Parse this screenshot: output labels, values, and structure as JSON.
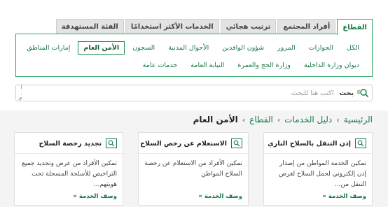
{
  "tabs": [
    {
      "label": "القطاع"
    },
    {
      "label": "أفراد المجتمع"
    },
    {
      "label": "ترتيب هجائي"
    },
    {
      "label": "الخدمات الأكثر استخدامًا"
    },
    {
      "label": "الفئة المستهدفة"
    }
  ],
  "sectors": {
    "row1": [
      "الكل",
      "الجوازات",
      "المرور",
      "شؤون الوافدين",
      "الأحوال المدنية",
      "السجون",
      "الأمن العام",
      "إمارات المناطق"
    ],
    "row2": [
      "ديوان وزارة الداخلية",
      "وزارة الحج والعمرة",
      "النيابة العامة",
      "خدمات عامة"
    ],
    "active": "الأمن العام"
  },
  "search": {
    "label": "بحث",
    "placeholder": "اكتب هنا للبحث",
    "side_marks": [
      "ا",
      ".",
      "ي"
    ]
  },
  "breadcrumb": {
    "items": [
      "الرئيسية",
      "دليل الخدمات",
      "القطاع"
    ],
    "separator": "›",
    "current": "الأمن العام"
  },
  "cards": [
    {
      "title": "إذن التنقل بالسلاح الناري",
      "description": "تمكين الخدمة المواطن من إصدار إذن إلكتروني لحمل السلاح لغرض التنقل من...",
      "link": "وصف الخدمة »"
    },
    {
      "title": "الاستعلام عن رخص السلاح",
      "description": "تمكين الأفراد من الاستعلام عن رخصة السلاح المواطن",
      "link": "وصف الخدمة »"
    },
    {
      "title": "تجديد رخصة السلاح",
      "description": "تمكين الأفراد من عرض وتجديد جميع التراخيص للأسلحة المسجلة تحت هويتهم...",
      "link": "وصف الخدمة »"
    }
  ],
  "colors": {
    "accent": "#1a7a48",
    "border_green": "#2fa866"
  }
}
